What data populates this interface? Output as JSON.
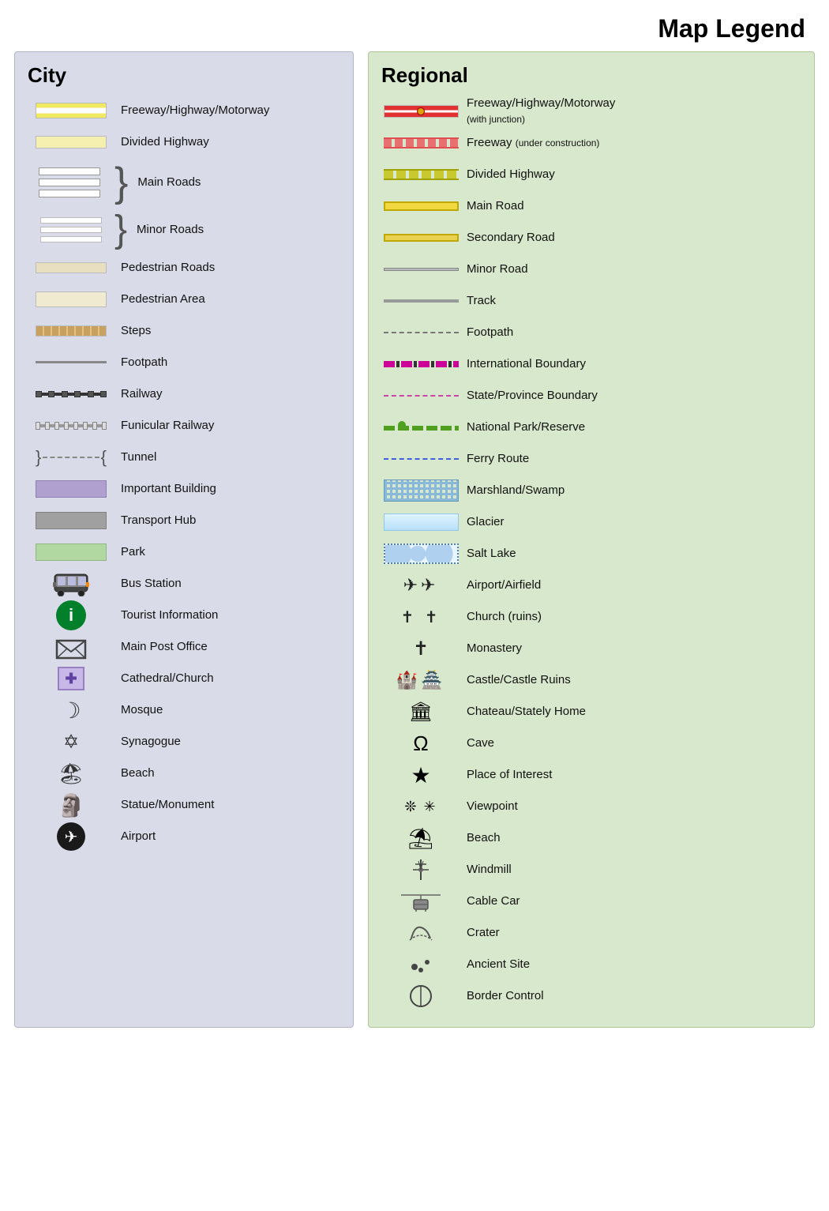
{
  "title": "Map Legend",
  "city": {
    "heading": "City",
    "items": [
      {
        "id": "freeway",
        "label": "Freeway/Highway/Motorway"
      },
      {
        "id": "divided-highway",
        "label": "Divided Highway"
      },
      {
        "id": "main-roads",
        "label": "Main Roads"
      },
      {
        "id": "minor-roads",
        "label": "Minor Roads"
      },
      {
        "id": "pedestrian-roads",
        "label": "Pedestrian Roads"
      },
      {
        "id": "pedestrian-area",
        "label": "Pedestrian Area"
      },
      {
        "id": "steps",
        "label": "Steps"
      },
      {
        "id": "footpath",
        "label": "Footpath"
      },
      {
        "id": "railway",
        "label": "Railway"
      },
      {
        "id": "funicular-railway",
        "label": "Funicular Railway"
      },
      {
        "id": "tunnel",
        "label": "Tunnel"
      },
      {
        "id": "important-building",
        "label": "Important Building"
      },
      {
        "id": "transport-hub",
        "label": "Transport Hub"
      },
      {
        "id": "park",
        "label": "Park"
      },
      {
        "id": "bus-station",
        "label": "Bus Station"
      },
      {
        "id": "tourist-information",
        "label": "Tourist Information"
      },
      {
        "id": "main-post-office",
        "label": "Main Post Office"
      },
      {
        "id": "cathedral-church",
        "label": "Cathedral/Church"
      },
      {
        "id": "mosque",
        "label": "Mosque"
      },
      {
        "id": "synagogue",
        "label": "Synagogue"
      },
      {
        "id": "beach",
        "label": "Beach"
      },
      {
        "id": "statue-monument",
        "label": "Statue/Monument"
      },
      {
        "id": "airport",
        "label": "Airport"
      }
    ]
  },
  "regional": {
    "heading": "Regional",
    "items": [
      {
        "id": "reg-freeway",
        "label": "Freeway/Highway/Motorway",
        "sublabel": "(with junction)"
      },
      {
        "id": "reg-freeway-construction",
        "label": "Freeway",
        "sublabel": "(under construction)"
      },
      {
        "id": "reg-divided-highway",
        "label": "Divided Highway"
      },
      {
        "id": "reg-main-road",
        "label": "Main Road"
      },
      {
        "id": "reg-secondary-road",
        "label": "Secondary Road"
      },
      {
        "id": "reg-minor-road",
        "label": "Minor Road"
      },
      {
        "id": "reg-track",
        "label": "Track"
      },
      {
        "id": "reg-footpath",
        "label": "Footpath"
      },
      {
        "id": "reg-int-boundary",
        "label": "International Boundary"
      },
      {
        "id": "reg-state-boundary",
        "label": "State/Province Boundary"
      },
      {
        "id": "reg-natpark",
        "label": "National Park/Reserve"
      },
      {
        "id": "reg-ferry",
        "label": "Ferry Route"
      },
      {
        "id": "reg-marshland",
        "label": "Marshland/Swamp"
      },
      {
        "id": "reg-glacier",
        "label": "Glacier"
      },
      {
        "id": "reg-saltlake",
        "label": "Salt Lake"
      },
      {
        "id": "reg-airport",
        "label": "Airport/Airfield"
      },
      {
        "id": "reg-church",
        "label": "Church (ruins)"
      },
      {
        "id": "reg-monastery",
        "label": "Monastery"
      },
      {
        "id": "reg-castle",
        "label": "Castle/Castle Ruins"
      },
      {
        "id": "reg-chateau",
        "label": "Chateau/Stately Home"
      },
      {
        "id": "reg-cave",
        "label": "Cave"
      },
      {
        "id": "reg-poi",
        "label": "Place of Interest"
      },
      {
        "id": "reg-viewpoint",
        "label": "Viewpoint"
      },
      {
        "id": "reg-beach",
        "label": "Beach"
      },
      {
        "id": "reg-windmill",
        "label": "Windmill"
      },
      {
        "id": "reg-cablecar",
        "label": "Cable Car"
      },
      {
        "id": "reg-crater",
        "label": "Crater"
      },
      {
        "id": "reg-ancientsite",
        "label": "Ancient Site"
      },
      {
        "id": "reg-bordercontrol",
        "label": "Border Control"
      }
    ]
  }
}
